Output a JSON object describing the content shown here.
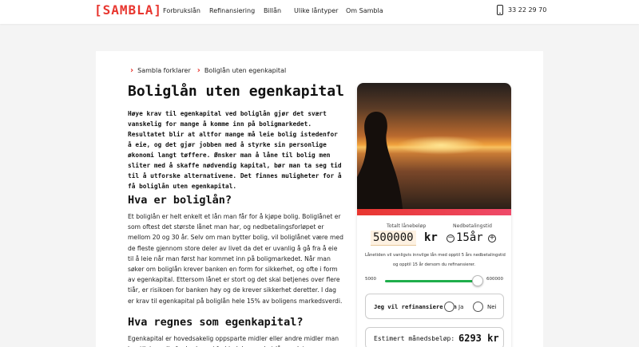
{
  "header": {
    "logo": "[SAMBLA]",
    "nav": [
      "Forbrukslån",
      "Refinansiering",
      "Billån",
      "Ulike låntyper",
      "Om Sambla"
    ],
    "phone": "33 22 29 70"
  },
  "breadcrumb": [
    "Sambla forklarer",
    "Boliglån uten egenkapital"
  ],
  "article": {
    "title": "Boliglån uten egenkapital",
    "lead": "Høye krav til egenkapital ved boliglån gjør det svært vanskelig for mange å komme inn på boligmarkedet. Resultatet blir at altfor mange må leie bolig istedenfor å eie, og det gjør jobben med å styrke sin personlige økonomi langt tøffere. Ønsker man å låne til bolig men sliter med å skaffe nødvendig kapital, bør man ta seg tid til å utforske alternativene. Det finnes muligheter for å få boliglån uten egenkapital.",
    "h2_1": "Hva er boliglån?",
    "p1": "Et boliglån er helt enkelt et lån man får for å kjøpe bolig. Boliglånet er som oftest det største lånet man har, og nedbetalingsforløpet er mellom 20 og 30 år. Selv om man bytter bolig, vil boliglånet være med de fleste gjennom store deler av livet da det er uvanlig å gå fra å eie til å leie når man først har kommet inn på boligmarkedet. Når man søker om boliglån krever banken en form for sikkerhet, og ofte i form av egenkapital. Ettersom lånet er stort og det skal betjenes over flere tiår, er risikoen for banken høy og de krever sikkerhet deretter. I dag er krav til egenkapital på boliglån hele 15% av boligens markedsverdi.",
    "h2_2": "Hva regnes som egenkapital?",
    "p2": "Egenkapital er hovedsakelig oppsparte midler eller andre midler man har tilgjengelig for bruk, og i forbindelse med et lån er det"
  },
  "calculator": {
    "loan_label": "Totalt lånebeløp",
    "loan_value": "500000",
    "currency": "kr",
    "term_label": "Nedbetalingstid",
    "term_value": "15år",
    "minus_symbol": "−",
    "plus_symbol": "+",
    "note_line1": "Lånetiden vil vanligvis innvilge lån med opptil 5 års nedbetalingstid",
    "note_line2": "og opptil 15 år dersom du refinansierer.",
    "slider_min": "5000",
    "slider_max": "600000",
    "slider_fraction": 0.83,
    "refinance_question": "Jeg vil refinansiere lån",
    "refinance_yes": "Ja",
    "refinance_no": "Nei",
    "estimate_label": "Estimert månedsbeløp:",
    "estimate_value": "6293 kr"
  },
  "colors": {
    "brand_red": "#e8362f",
    "slider_green": "#1fae4b"
  },
  "icons": [
    "phone-icon",
    "chevron-right-icon",
    "minus-circle-icon",
    "plus-circle-icon",
    "radio-icon"
  ]
}
